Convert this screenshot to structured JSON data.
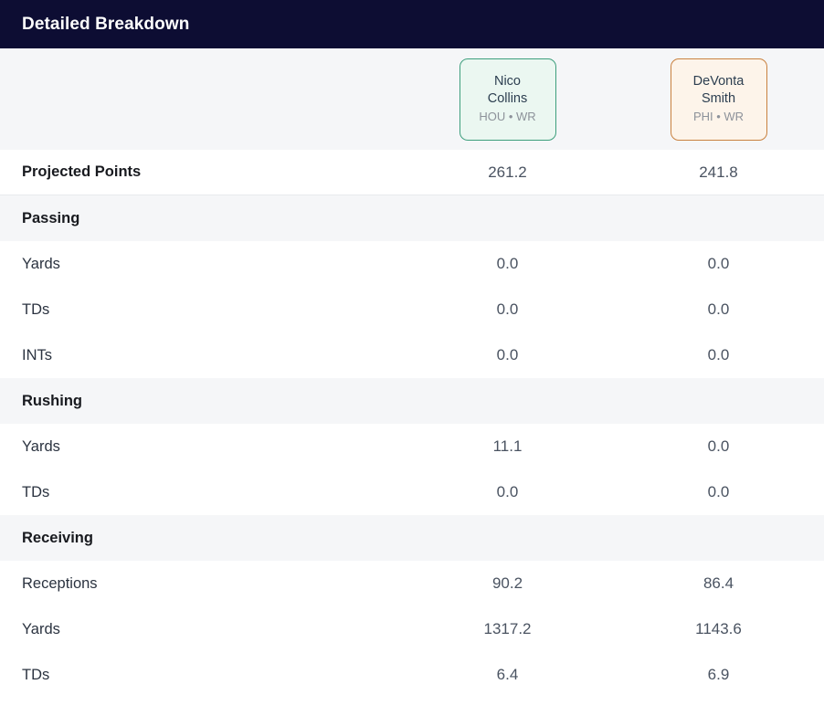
{
  "header": {
    "title": "Detailed Breakdown",
    "background_color": "#0d0d33",
    "text_color": "#ffffff"
  },
  "players": [
    {
      "name": "Nico Collins",
      "name_line1": "Nico",
      "name_line2": "Collins",
      "team": "HOU",
      "position": "WR",
      "meta": "HOU • WR",
      "accent_color": "#3d9e7c",
      "background_color": "#ebf7f1"
    },
    {
      "name": "DeVonta Smith",
      "name_line1": "DeVonta",
      "name_line2": "Smith",
      "team": "PHI",
      "position": "WR",
      "meta": "PHI • WR",
      "accent_color": "#c9813f",
      "background_color": "#fdf4ea"
    }
  ],
  "total_row": {
    "label": "Projected Points",
    "values": [
      "261.2",
      "241.8"
    ]
  },
  "sections": [
    {
      "title": "Passing",
      "rows": [
        {
          "label": "Yards",
          "values": [
            "0.0",
            "0.0"
          ]
        },
        {
          "label": "TDs",
          "values": [
            "0.0",
            "0.0"
          ]
        },
        {
          "label": "INTs",
          "values": [
            "0.0",
            "0.0"
          ]
        }
      ]
    },
    {
      "title": "Rushing",
      "rows": [
        {
          "label": "Yards",
          "values": [
            "11.1",
            "0.0"
          ]
        },
        {
          "label": "TDs",
          "values": [
            "0.0",
            "0.0"
          ]
        }
      ]
    },
    {
      "title": "Receiving",
      "rows": [
        {
          "label": "Receptions",
          "values": [
            "90.2",
            "86.4"
          ]
        },
        {
          "label": "Yards",
          "values": [
            "1317.2",
            "1143.6"
          ]
        },
        {
          "label": "TDs",
          "values": [
            "6.4",
            "6.9"
          ]
        }
      ]
    }
  ]
}
